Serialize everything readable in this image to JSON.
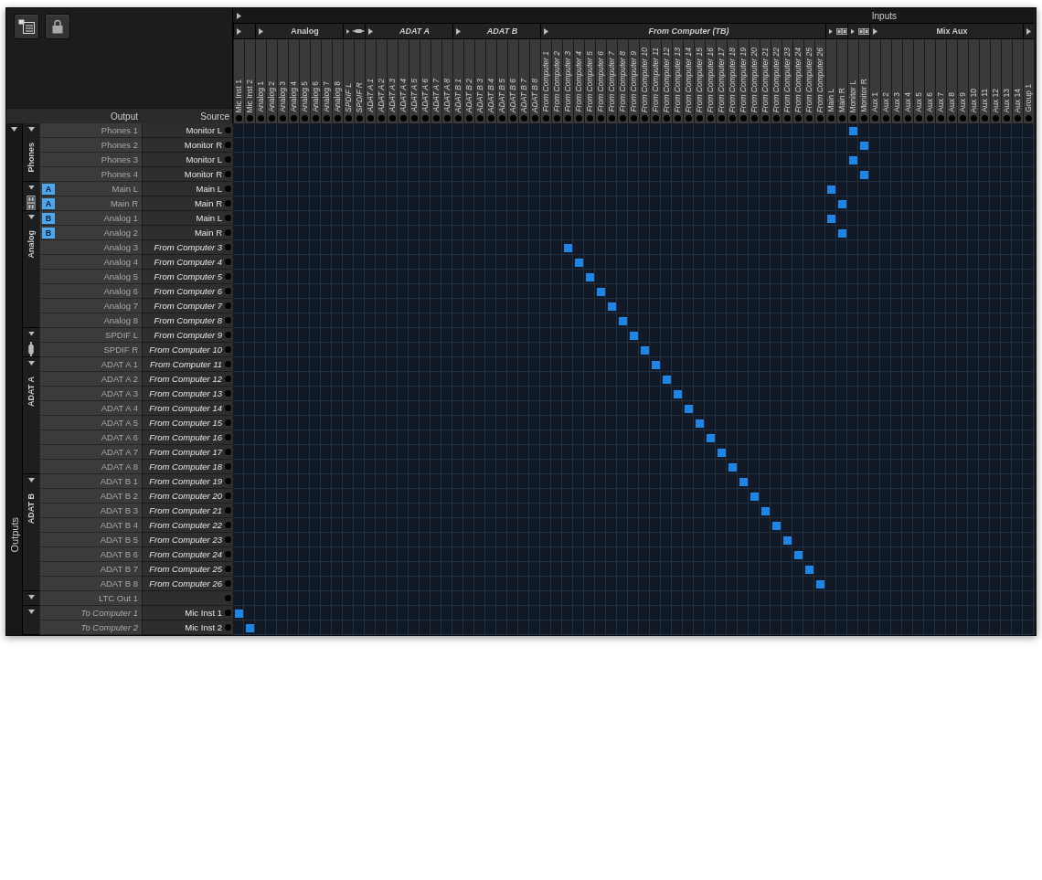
{
  "inputs_title": "Inputs",
  "outputs_title": "Outputs",
  "headings": {
    "output": "Output",
    "source": "Source"
  },
  "column_groups": [
    {
      "kind": "plain",
      "italic": false,
      "columns": [
        "Mic Inst 1",
        "Mic Inst 2"
      ]
    },
    {
      "kind": "labeled",
      "label": "Analog",
      "italic": false,
      "columns": [
        "Analog 1",
        "Analog 2",
        "Analog 3",
        "Analog 4",
        "Analog 5",
        "Analog 6",
        "Analog 7",
        "Analog 8"
      ]
    },
    {
      "kind": "connector",
      "italic": true,
      "columns": [
        "SPDIF L",
        "SPDIF R"
      ]
    },
    {
      "kind": "labeled",
      "label": "ADAT A",
      "italic": true,
      "columns": [
        "ADAT A 1",
        "ADAT A 2",
        "ADAT A 3",
        "ADAT A 4",
        "ADAT A 5",
        "ADAT A 6",
        "ADAT A 7",
        "ADAT A 8"
      ]
    },
    {
      "kind": "labeled",
      "label": "ADAT B",
      "italic": true,
      "columns": [
        "ADAT B 1",
        "ADAT B 2",
        "ADAT B 3",
        "ADAT B 4",
        "ADAT B 5",
        "ADAT B 6",
        "ADAT B 7",
        "ADAT B 8"
      ]
    },
    {
      "kind": "labeled",
      "label": "From Computer (TB)",
      "italic": true,
      "columns": [
        "From Computer 1",
        "From Computer 2",
        "From Computer 3",
        "From Computer 4",
        "From Computer 5",
        "From Computer 6",
        "From Computer 7",
        "From Computer 8",
        "From Computer 9",
        "From Computer 10",
        "From Computer 11",
        "From Computer 12",
        "From Computer 13",
        "From Computer 14",
        "From Computer 15",
        "From Computer 16",
        "From Computer 17",
        "From Computer 18",
        "From Computer 19",
        "From Computer 20",
        "From Computer 21",
        "From Computer 22",
        "From Computer 23",
        "From Computer 24",
        "From Computer 25",
        "From Computer 26"
      ]
    },
    {
      "kind": "pair",
      "italic": false,
      "columns": [
        "Main L",
        "Main R"
      ]
    },
    {
      "kind": "pair",
      "italic": false,
      "columns": [
        "Monitor L",
        "Monitor R"
      ]
    },
    {
      "kind": "labeled",
      "label": "Mix Aux",
      "italic": false,
      "columns": [
        "Aux 1",
        "Aux 2",
        "Aux 3",
        "Aux 4",
        "Aux 5",
        "Aux 6",
        "Aux 7",
        "Aux 8",
        "Aux 9",
        "Aux 10",
        "Aux 11",
        "Aux 12",
        "Aux 13",
        "Aux 14"
      ]
    },
    {
      "kind": "plain",
      "italic": false,
      "columns": [
        "Group 1"
      ]
    }
  ],
  "row_groups": [
    {
      "kind": "labeled",
      "label": "Phones",
      "rows": [
        {
          "output": "Phones 1",
          "source": "Monitor L",
          "source_italic": false,
          "output_italic": false
        },
        {
          "output": "Phones 2",
          "source": "Monitor R",
          "source_italic": false,
          "output_italic": false
        },
        {
          "output": "Phones 3",
          "source": "Monitor L",
          "source_italic": false,
          "output_italic": false
        },
        {
          "output": "Phones 4",
          "source": "Monitor R",
          "source_italic": false,
          "output_italic": false
        }
      ]
    },
    {
      "kind": "pair",
      "rows": [
        {
          "badge": "A",
          "output": "Main L",
          "source": "Main L",
          "source_italic": false,
          "output_italic": false
        },
        {
          "badge": "A",
          "output": "Main R",
          "source": "Main R",
          "source_italic": false,
          "output_italic": false
        }
      ]
    },
    {
      "kind": "labeled",
      "label": "Analog",
      "rows": [
        {
          "badge": "B",
          "output": "Analog 1",
          "source": "Main L",
          "source_italic": false,
          "output_italic": false
        },
        {
          "badge": "B",
          "output": "Analog 2",
          "source": "Main R",
          "source_italic": false,
          "output_italic": false
        },
        {
          "output": "Analog 3",
          "source": "From Computer 3",
          "source_italic": true,
          "output_italic": false
        },
        {
          "output": "Analog 4",
          "source": "From Computer 4",
          "source_italic": true,
          "output_italic": false
        },
        {
          "output": "Analog 5",
          "source": "From Computer 5",
          "source_italic": true,
          "output_italic": false
        },
        {
          "output": "Analog 6",
          "source": "From Computer 6",
          "source_italic": true,
          "output_italic": false
        },
        {
          "output": "Analog 7",
          "source": "From Computer 7",
          "source_italic": true,
          "output_italic": false
        },
        {
          "output": "Analog 8",
          "source": "From Computer 8",
          "source_italic": true,
          "output_italic": false
        }
      ]
    },
    {
      "kind": "connector",
      "rows": [
        {
          "output": "SPDIF L",
          "source": "From Computer 9",
          "source_italic": true,
          "output_italic": false
        },
        {
          "output": "SPDIF R",
          "source": "From Computer 10",
          "source_italic": true,
          "output_italic": false
        }
      ]
    },
    {
      "kind": "labeled",
      "label": "ADAT A",
      "rows": [
        {
          "output": "ADAT A 1",
          "source": "From Computer 11",
          "source_italic": true,
          "output_italic": false
        },
        {
          "output": "ADAT A 2",
          "source": "From Computer 12",
          "source_italic": true,
          "output_italic": false
        },
        {
          "output": "ADAT A 3",
          "source": "From Computer 13",
          "source_italic": true,
          "output_italic": false
        },
        {
          "output": "ADAT A 4",
          "source": "From Computer 14",
          "source_italic": true,
          "output_italic": false
        },
        {
          "output": "ADAT A 5",
          "source": "From Computer 15",
          "source_italic": true,
          "output_italic": false
        },
        {
          "output": "ADAT A 6",
          "source": "From Computer 16",
          "source_italic": true,
          "output_italic": false
        },
        {
          "output": "ADAT A 7",
          "source": "From Computer 17",
          "source_italic": true,
          "output_italic": false
        },
        {
          "output": "ADAT A 8",
          "source": "From Computer 18",
          "source_italic": true,
          "output_italic": false
        }
      ]
    },
    {
      "kind": "labeled",
      "label": "ADAT B",
      "rows": [
        {
          "output": "ADAT B 1",
          "source": "From Computer 19",
          "source_italic": true,
          "output_italic": false
        },
        {
          "output": "ADAT B 2",
          "source": "From Computer 20",
          "source_italic": true,
          "output_italic": false
        },
        {
          "output": "ADAT B 3",
          "source": "From Computer 21",
          "source_italic": true,
          "output_italic": false
        },
        {
          "output": "ADAT B 4",
          "source": "From Computer 22",
          "source_italic": true,
          "output_italic": false
        },
        {
          "output": "ADAT B 5",
          "source": "From Computer 23",
          "source_italic": true,
          "output_italic": false
        },
        {
          "output": "ADAT B 6",
          "source": "From Computer 24",
          "source_italic": true,
          "output_italic": false
        },
        {
          "output": "ADAT B 7",
          "source": "From Computer 25",
          "source_italic": true,
          "output_italic": false
        },
        {
          "output": "ADAT B 8",
          "source": "From Computer 26",
          "source_italic": true,
          "output_italic": false
        }
      ]
    },
    {
      "kind": "plain",
      "rows": [
        {
          "output": "LTC Out 1",
          "output_italic": false
        }
      ]
    },
    {
      "kind": "plain",
      "rows": [
        {
          "output": "To Computer 1",
          "source": "Mic Inst 1",
          "source_italic": false,
          "output_italic": true
        },
        {
          "output": "To Computer 2",
          "source": "Mic Inst 2",
          "source_italic": false,
          "output_italic": true
        }
      ]
    }
  ]
}
